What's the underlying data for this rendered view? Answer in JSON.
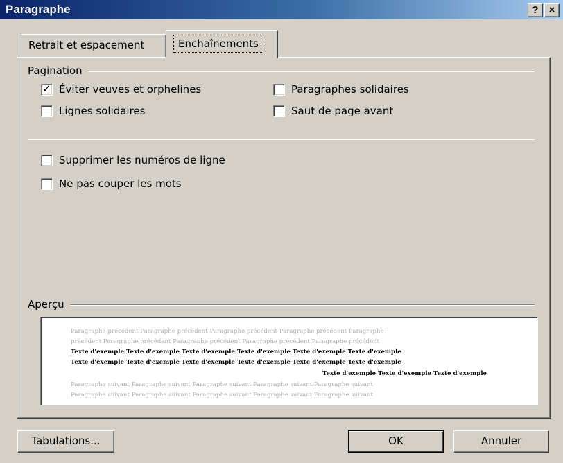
{
  "window": {
    "title": "Paragraphe",
    "help_glyph": "?",
    "close_glyph": "×"
  },
  "tabs": [
    {
      "label": "Retrait et espacement",
      "active": false
    },
    {
      "label": "Enchaînements",
      "active": true
    }
  ],
  "pagination": {
    "label": "Pagination",
    "options": [
      {
        "label": "Éviter veuves et orphelines",
        "checked": true
      },
      {
        "label": "Lignes solidaires",
        "checked": false
      },
      {
        "label": "Paragraphes solidaires",
        "checked": false
      },
      {
        "label": "Saut de page avant",
        "checked": false
      }
    ]
  },
  "other_options": [
    {
      "label": "Supprimer les numéros de ligne",
      "checked": false
    },
    {
      "label": "Ne pas couper les mots",
      "checked": false
    }
  ],
  "preview": {
    "label": "Aperçu",
    "lines": [
      "Paragraphe précédent Paragraphe précédent Paragraphe précédent Paragraphe précédent Paragraphe",
      "précédent Paragraphe précédent Paragraphe précédent Paragraphe précédent Paragraphe précédent",
      "Texte d'exemple Texte d'exemple Texte d'exemple Texte d'exemple Texte d'exemple Texte d'exemple",
      "Texte d'exemple Texte d'exemple Texte d'exemple Texte d'exemple Texte d'exemple Texte d'exemple",
      "Texte d'exemple Texte d'exemple Texte d'exemple",
      "Paragraphe suivant Paragraphe suivant Paragraphe suivant Paragraphe suivant Paragraphe suivant",
      "Paragraphe suivant Paragraphe suivant Paragraphe suivant Paragraphe suivant Paragraphe suivant"
    ]
  },
  "buttons": {
    "tabulations": "Tabulations...",
    "ok": "OK",
    "cancel": "Annuler"
  },
  "colors": {
    "dialog_bg": "#d4d0c8",
    "title_start": "#0a246a",
    "title_end": "#a6caf0",
    "preview_gray": "#b0b0b0"
  }
}
